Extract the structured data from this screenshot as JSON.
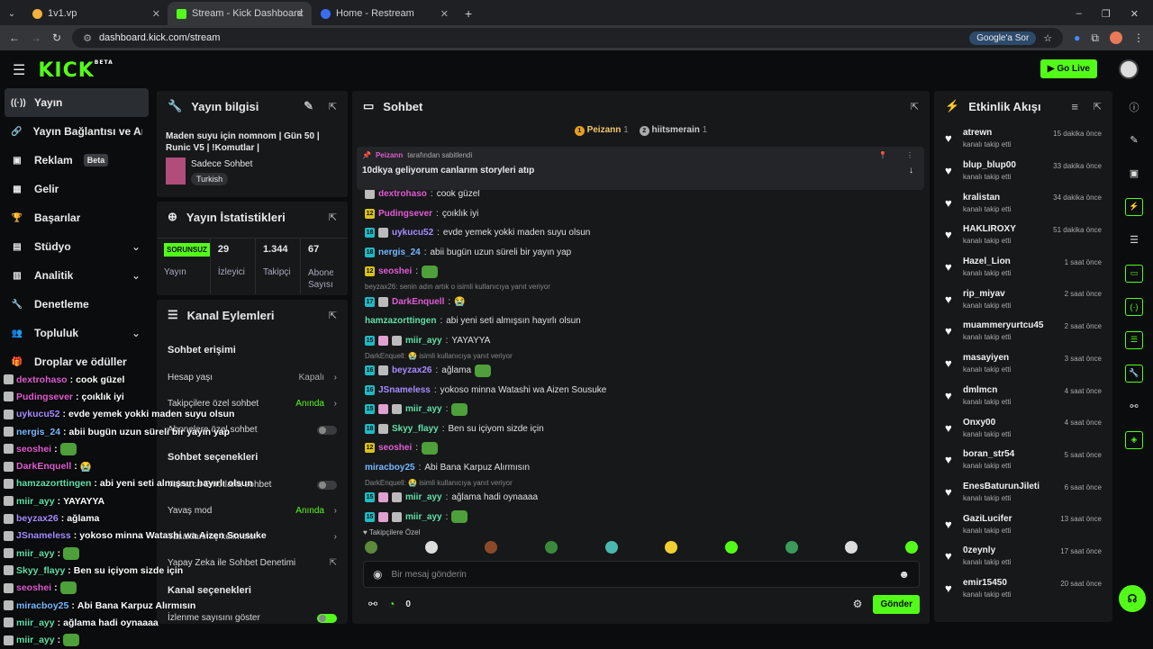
{
  "browser": {
    "tabs": [
      {
        "title": "1v1.vp",
        "color": "#f2b23d"
      },
      {
        "title": "Stream - Kick Dashboard",
        "color": "#53fc18"
      },
      {
        "title": "Home - Restream",
        "color": "#3a6df0"
      }
    ],
    "url": "dashboard.kick.com/stream",
    "google_pill": "Google'a Sor"
  },
  "header": {
    "logo": "KICK",
    "beta": "BETA",
    "go_live": "Go Live"
  },
  "sidebar": {
    "items": [
      {
        "label": "Yayın",
        "icon": "broadcast-icon",
        "glyph": "((·))",
        "active": true
      },
      {
        "label": "Yayın Bağlantısı ve Anahtarı",
        "icon": "link-icon",
        "glyph": "🔗"
      },
      {
        "label": "Reklam",
        "icon": "ad-icon",
        "glyph": "▣",
        "badge": "Beta"
      },
      {
        "label": "Gelir",
        "icon": "revenue-icon",
        "glyph": "▦"
      },
      {
        "label": "Başarılar",
        "icon": "trophy-icon",
        "glyph": "🏆"
      },
      {
        "label": "Stüdyo",
        "icon": "studio-icon",
        "glyph": "▤",
        "chevron": true
      },
      {
        "label": "Analitik",
        "icon": "analytics-icon",
        "glyph": "▥",
        "chevron": true
      },
      {
        "label": "Denetleme",
        "icon": "moderation-icon",
        "glyph": "🔧"
      },
      {
        "label": "Topluluk",
        "icon": "community-icon",
        "glyph": "👥",
        "chevron": true
      },
      {
        "label": "Droplar ve ödüller",
        "icon": "gift-icon",
        "glyph": "🎁"
      }
    ]
  },
  "stream_info": {
    "title": "Yayın bilgisi",
    "stream_title": "Maden suyu için nomnom | Gün 50 | Runic V5 | !Komutlar |",
    "category": "Sadece Sohbet",
    "language": "Turkish"
  },
  "stats": {
    "title": "Yayın İstatistikleri",
    "items": [
      {
        "value": "SORUNSUZ",
        "label": "Yayın",
        "badge": true
      },
      {
        "value": "29",
        "label": "İzleyici"
      },
      {
        "value": "1.344",
        "label": "Takipçi"
      },
      {
        "value": "67",
        "label": "Abone Sayısı"
      }
    ]
  },
  "channel_actions": {
    "title": "Kanal Eylemleri",
    "section1": "Sohbet erişimi",
    "rows1": [
      {
        "label": "Hesap yaşı",
        "value": "Kapalı",
        "type": "link",
        "gray": true
      },
      {
        "label": "Takipçilere özel sohbet",
        "value": "Anında",
        "type": "link"
      },
      {
        "label": "Abonelere özel sohbet",
        "type": "toggle"
      }
    ],
    "section2": "Sohbet seçenekleri",
    "rows2": [
      {
        "label": "Yalnızca Emotlarla sohbet",
        "type": "toggle"
      },
      {
        "label": "Yavaş mod",
        "value": "Anında",
        "type": "link"
      },
      {
        "label": "Yasaklanmış kelimeler",
        "type": "link"
      },
      {
        "label": "Yapay Zeka ile Sohbet Denetimi",
        "type": "external"
      }
    ],
    "section3": "Kanal seçenekleri",
    "rows3": [
      {
        "label": "İzlenme sayısını göster",
        "type": "toggle-on"
      }
    ]
  },
  "chat": {
    "title": "Sohbet",
    "top_gifters": [
      {
        "name": "Peizann",
        "count": "1",
        "rank": "1"
      },
      {
        "name": "hiitsmerain",
        "count": "1",
        "rank": "2"
      }
    ],
    "pinned": {
      "by": "Peizann",
      "by_suffix": "tarafından sabitlendi",
      "text": "10dkya geliyorum canlarım storyleri atıp"
    },
    "messages": [
      {
        "badge": "",
        "user": "dextrohaso",
        "color": "#e05cd3",
        "text": "cook güzel",
        "avatar": true
      },
      {
        "badge": "12",
        "user": "Pudingsever",
        "color": "#e05cd3",
        "text": "çoıklık iyi"
      },
      {
        "badge": "18",
        "user": "uykucu52",
        "color": "#a88cff",
        "text": "evde yemek yokki maden suyu olsun",
        "avatar": true
      },
      {
        "badge": "18",
        "user": "nergis_24",
        "color": "#74b9ff",
        "text": "abii bugün uzun süreli bir yayın yap"
      },
      {
        "badge": "12",
        "user": "seoshei",
        "color": "#e05cd3",
        "text": "",
        "emote": true
      },
      {
        "reply": "beyzax26: senin adın artık o isimli kullanıcıya yanıt veriyor"
      },
      {
        "badge": "17",
        "user": "DarkEnquell",
        "color": "#e05cd3",
        "text": "😭",
        "avatar": true
      },
      {
        "badge": "",
        "user": "hamzazorttingen",
        "color": "#5fe0a8",
        "text": "abi yeni seti almışsın hayırlı olsun"
      },
      {
        "badge": "15",
        "user": "miir_ayy",
        "color": "#5fe0a8",
        "text": "YAYAYYA",
        "avatar": true,
        "tier": true
      },
      {
        "reply": "DarkEnquell: 😭 isimli kullanıcıya yanıt veriyor"
      },
      {
        "badge": "16",
        "user": "beyzax26",
        "color": "#a88cff",
        "text": "ağlama",
        "avatar": true,
        "emote": true
      },
      {
        "badge": "16",
        "user": "JSnameless",
        "color": "#a88cff",
        "text": "yokoso minna Watashi wa Aizen Sousuke"
      },
      {
        "badge": "15",
        "user": "miir_ayy",
        "color": "#5fe0a8",
        "text": "",
        "avatar": true,
        "tier": true,
        "emote": true
      },
      {
        "badge": "18",
        "user": "Skyy_flayy",
        "color": "#5fe0a8",
        "text": "Ben su içiyom sizde için",
        "avatar": true
      },
      {
        "badge": "12",
        "user": "seoshei",
        "color": "#e05cd3",
        "text": "",
        "emote": true
      },
      {
        "badge": "",
        "user": "miracboy25",
        "color": "#74b9ff",
        "text": "Abi Bana Karpuz Alırmısın"
      },
      {
        "reply": "DarkEnquell: 😭 isimli kullanıcıya yanıt veriyor"
      },
      {
        "badge": "15",
        "user": "miir_ayy",
        "color": "#5fe0a8",
        "text": "ağlama hadi oynaaaa",
        "avatar": true,
        "tier": true
      },
      {
        "badge": "15",
        "user": "miir_ayy",
        "color": "#5fe0a8",
        "text": "",
        "avatar": true,
        "tier": true,
        "emote": true
      }
    ],
    "followers_only": "Takipçilere Özel",
    "input_placeholder": "Bir mesaj gönderin",
    "points": "0",
    "send": "Gönder"
  },
  "activity": {
    "title": "Etkinlik Akışı",
    "followed": "kanalı takip etti",
    "items": [
      {
        "user": "atrewn",
        "time": "15 dakika önce"
      },
      {
        "user": "blup_blup00",
        "time": "33 dakika önce"
      },
      {
        "user": "kralistan",
        "time": "34 dakika önce"
      },
      {
        "user": "HAKLIROXY",
        "time": "51 dakika önce"
      },
      {
        "user": "Hazel_Lion",
        "time": "1 saat önce"
      },
      {
        "user": "rip_miyav",
        "time": "2 saat önce"
      },
      {
        "user": "muammeryurtcu45",
        "time": "2 saat önce"
      },
      {
        "user": "masayiyen",
        "time": "3 saat önce"
      },
      {
        "user": "dmlmcn",
        "time": "4 saat önce"
      },
      {
        "user": "Onxy00",
        "time": "4 saat önce"
      },
      {
        "user": "boran_str54",
        "time": "5 saat önce"
      },
      {
        "user": "EnesBaturunJileti",
        "time": "6 saat önce"
      },
      {
        "user": "GaziLucifer",
        "time": "13 saat önce"
      },
      {
        "user": "0zeynly",
        "time": "17 saat önce"
      },
      {
        "user": "emir15450",
        "time": "20 saat önce"
      }
    ]
  },
  "overlay": [
    {
      "user": "dextrohaso",
      "color": "#e05cd3",
      "text": "cook güzel"
    },
    {
      "user": "Pudingsever",
      "color": "#e05cd3",
      "text": "çoıklık iyi"
    },
    {
      "user": "uykucu52",
      "color": "#a88cff",
      "text": "evde yemek yokki maden suyu olsun"
    },
    {
      "user": "nergis_24",
      "color": "#74b9ff",
      "text": "abii bugün uzun süreli bir yayın yap"
    },
    {
      "user": "seoshei",
      "color": "#e05cd3",
      "text": ""
    },
    {
      "user": "DarkEnquell",
      "color": "#e05cd3",
      "text": "😭"
    },
    {
      "user": "hamzazorttingen",
      "color": "#5fe0a8",
      "text": "abi yeni seti almışsın hayırlı olsun"
    },
    {
      "user": "miir_ayy",
      "color": "#5fe0a8",
      "text": "YAYAYYA"
    },
    {
      "user": "beyzax26",
      "color": "#a88cff",
      "text": "ağlama"
    },
    {
      "user": "JSnameless",
      "color": "#a88cff",
      "text": "yokoso minna Watashi wa Aizen Sousuke"
    },
    {
      "user": "miir_ayy",
      "color": "#5fe0a8",
      "text": ""
    },
    {
      "user": "Skyy_flayy",
      "color": "#5fe0a8",
      "text": "Ben su içiyom sizde için"
    },
    {
      "user": "seoshei",
      "color": "#e05cd3",
      "text": ""
    },
    {
      "user": "miracboy25",
      "color": "#74b9ff",
      "text": "Abi Bana Karpuz Alırmısın"
    },
    {
      "user": "miir_ayy",
      "color": "#5fe0a8",
      "text": "ağlama hadi oynaaaa"
    },
    {
      "user": "miir_ayy",
      "color": "#5fe0a8",
      "text": ""
    }
  ],
  "colors": {
    "accent": "#53fc18",
    "panel": "#17181a",
    "background": "#0b0c0d"
  }
}
